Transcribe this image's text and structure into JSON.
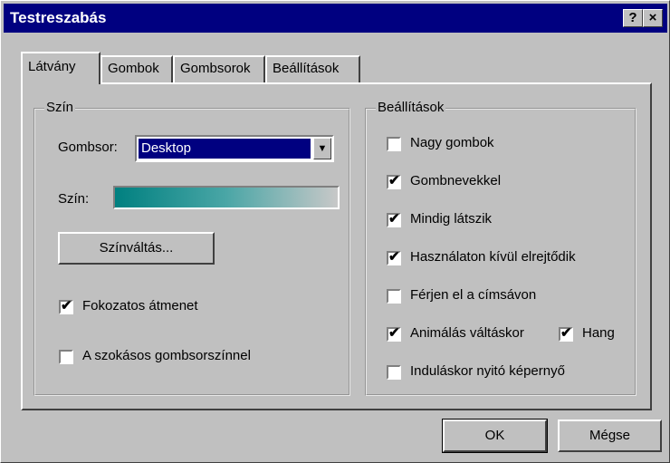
{
  "window": {
    "title": "Testreszabás",
    "help_label": "?",
    "close_label": "×"
  },
  "tabs": [
    {
      "label": "Látvány"
    },
    {
      "label": "Gombok"
    },
    {
      "label": "Gombsorok"
    },
    {
      "label": "Beállítások"
    }
  ],
  "szin_group": {
    "title": "Szín",
    "gombsor_label": "Gombsor:",
    "gombsor_value": "Desktop",
    "szin_label": "Szín:",
    "colorchange_button": "Színváltás...",
    "fokozatos": {
      "label": "Fokozatos átmenet",
      "checked": true
    },
    "szokasos": {
      "label": "A szokásos gombsorszínnel",
      "checked": false
    }
  },
  "beallitasok_group": {
    "title": "Beállítások",
    "options": [
      {
        "label": "Nagy gombok",
        "checked": false
      },
      {
        "label": "Gombnevekkel",
        "checked": true
      },
      {
        "label": "Mindig látszik",
        "checked": true
      },
      {
        "label": "Használaton kívül elrejtődik",
        "checked": true
      },
      {
        "label": "Férjen el a címsávon",
        "checked": false
      },
      {
        "label": "Animálás váltáskor",
        "checked": true
      },
      {
        "label": "Induláskor nyitó képernyő",
        "checked": false
      }
    ],
    "hang": {
      "label": "Hang",
      "checked": true
    }
  },
  "footer": {
    "ok_label": "OK",
    "cancel_label": "Mégse"
  },
  "colors": {
    "titlebar": "#000080",
    "face": "#c0c0c0",
    "gradient_start": "#008080"
  }
}
